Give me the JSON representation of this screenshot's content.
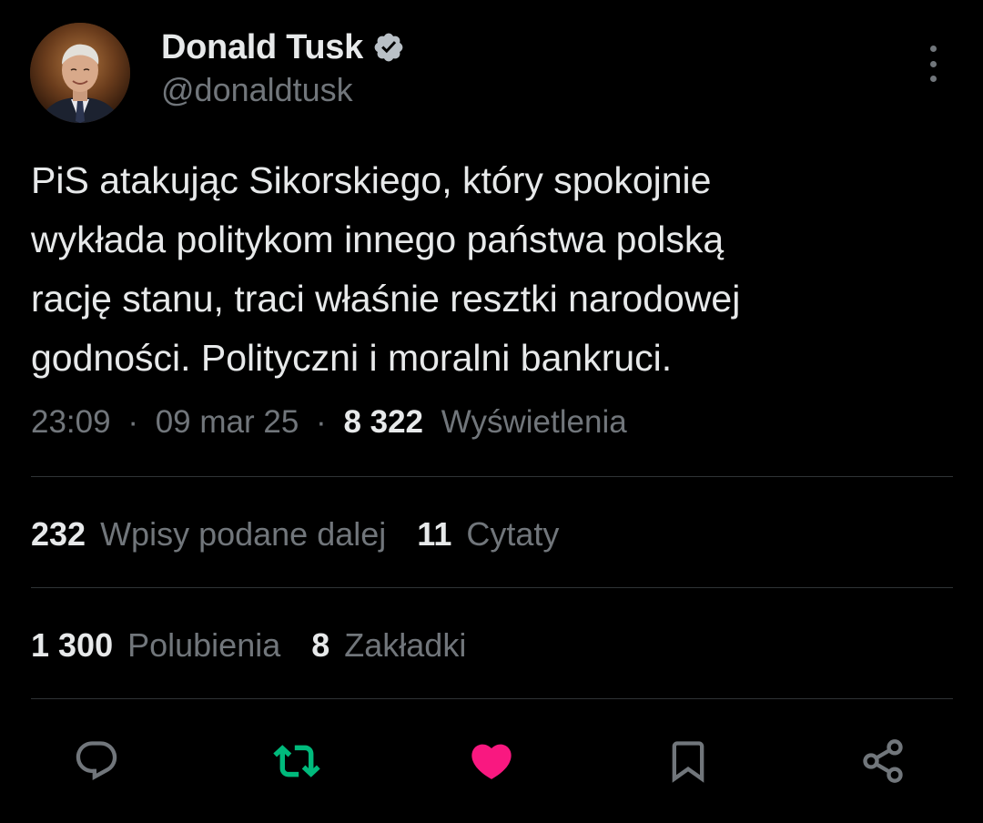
{
  "author": {
    "display_name": "Donald Tusk",
    "handle": "@donaldtusk",
    "verified": true,
    "verified_color": "#1d9bf0"
  },
  "tweet": {
    "text": "PiS atakując Sikorskiego, który spokojnie\nwykłada politykom innego państwa polską\nrację stanu, traci właśnie resztki narodowej\ngodności. Polityczni i moralni bankruci.",
    "time": "23:09",
    "separator": "·",
    "date": "09 mar 25",
    "views_count": "8 322",
    "views_label": "Wyświetlenia"
  },
  "stats": {
    "reposts_count": "232",
    "reposts_label": "Wpisy podane dalej",
    "quotes_count": "11",
    "quotes_label": "Cytaty",
    "likes_count": "1 300",
    "likes_label": "Polubienia",
    "bookmarks_count": "8",
    "bookmarks_label": "Zakładki"
  },
  "actions": [
    {
      "name": "reply",
      "icon": "reply-icon",
      "color": "#71767b"
    },
    {
      "name": "repost",
      "icon": "repost-icon",
      "color": "#00ba7c",
      "active": true
    },
    {
      "name": "like",
      "icon": "heart-icon",
      "color": "#f91880",
      "active": true
    },
    {
      "name": "bookmark",
      "icon": "bookmark-icon",
      "color": "#71767b"
    },
    {
      "name": "share",
      "icon": "share-icon",
      "color": "#71767b"
    }
  ],
  "colors": {
    "background": "#000000",
    "text_primary": "#e7e9ea",
    "text_secondary": "#71767b",
    "divider": "#2f3336"
  }
}
